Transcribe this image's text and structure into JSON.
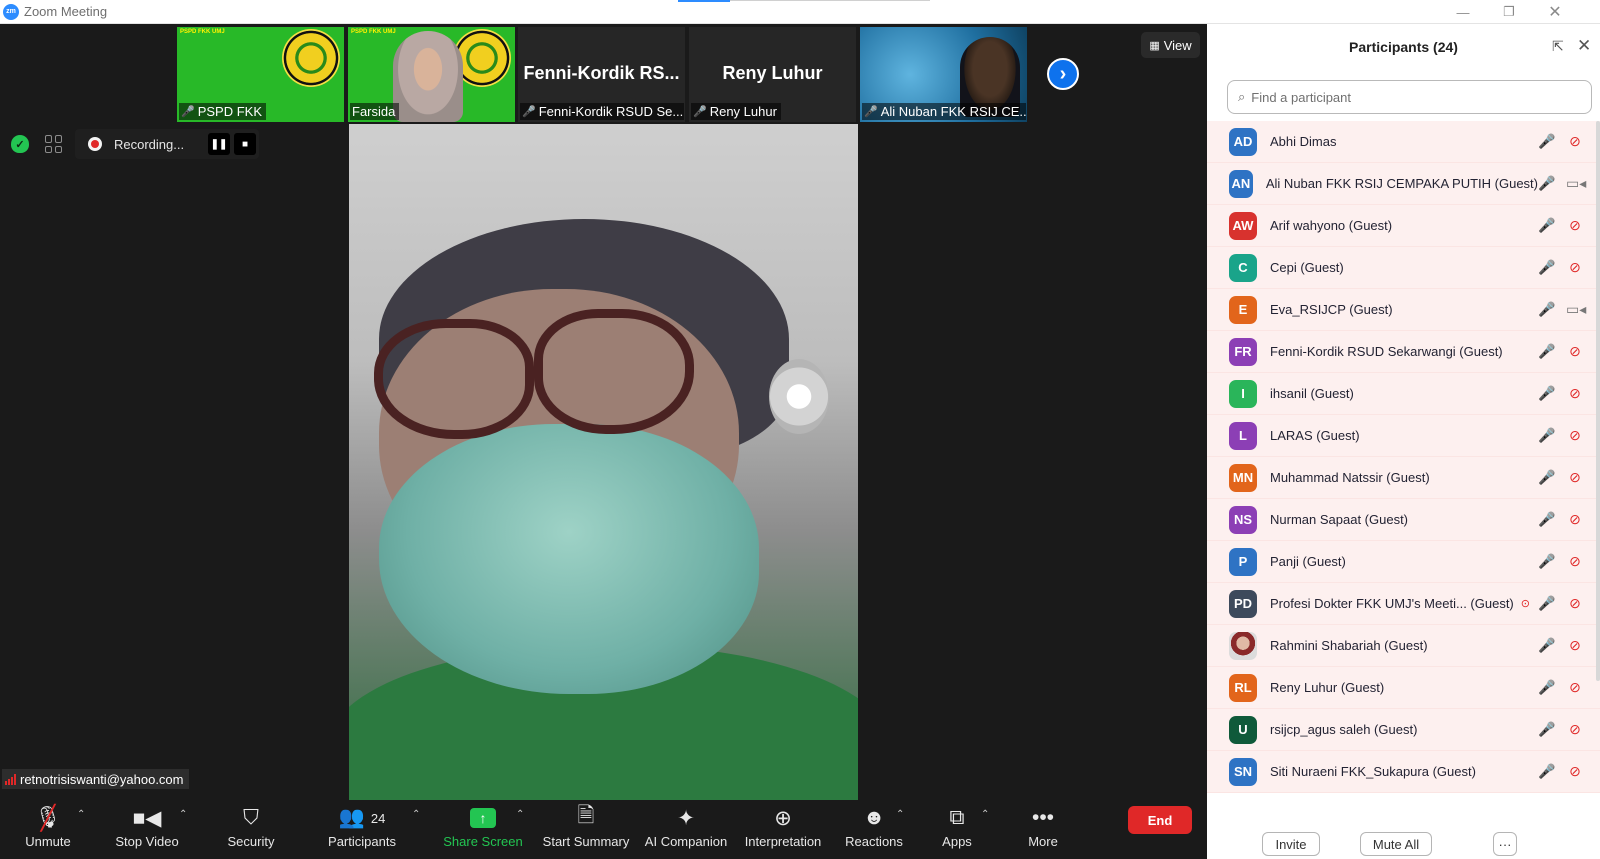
{
  "window": {
    "title": "Zoom Meeting",
    "logo": "zm"
  },
  "video_strip": {
    "tiles": [
      {
        "name": "PSPD FKK",
        "big_name": "",
        "kind": "green",
        "muted": true,
        "slide_text": "PSPD FKK UMJ"
      },
      {
        "name": "Farsida",
        "big_name": "",
        "kind": "green-face",
        "muted": false,
        "slide_text": "PSPD FKK UMJ"
      },
      {
        "name": "Fenni-Kordik RSUD Se...",
        "big_name": "Fenni-Kordik  RS...",
        "kind": "dark",
        "muted": true
      },
      {
        "name": "Reny Luhur",
        "big_name": "Reny Luhur",
        "kind": "dark",
        "muted": true
      },
      {
        "name": "Ali Nuban FKK RSIJ CE...",
        "big_name": "",
        "kind": "photo",
        "muted": true
      }
    ],
    "next_icon": "chevron-right-icon",
    "view_label": "View"
  },
  "recording": {
    "label": "Recording...",
    "pause_icon": "pause-icon",
    "stop_icon": "stop-icon"
  },
  "speaker": {
    "email_label": "retnotrisiswanti@yahoo.com"
  },
  "toolbar": {
    "unmute": "Unmute",
    "stop_video": "Stop Video",
    "security": "Security",
    "participants": "Participants",
    "participants_count": "24",
    "share_screen": "Share Screen",
    "start_summary": "Start Summary",
    "ai_companion": "AI Companion",
    "interpretation": "Interpretation",
    "reactions": "Reactions",
    "apps": "Apps",
    "more": "More",
    "end": "End"
  },
  "panel": {
    "title": "Participants (24)",
    "search_placeholder": "Find a participant",
    "participants": [
      {
        "initials": "AD",
        "name": "Abhi Dimas",
        "color": "#2e73c4",
        "camera_on": false,
        "recording": false
      },
      {
        "initials": "AN",
        "name": "Ali Nuban FKK RSIJ CEMPAKA PUTIH (Guest)",
        "color": "#2e73c4",
        "camera_on": true,
        "recording": false
      },
      {
        "initials": "AW",
        "name": "Arif wahyono (Guest)",
        "color": "#d8322e",
        "camera_on": false,
        "recording": false
      },
      {
        "initials": "C",
        "name": "Cepi (Guest)",
        "color": "#1aa48a",
        "camera_on": false,
        "recording": false
      },
      {
        "initials": "E",
        "name": "Eva_RSIJCP (Guest)",
        "color": "#e2651b",
        "camera_on": true,
        "recording": false
      },
      {
        "initials": "FR",
        "name": "Fenni-Kordik RSUD Sekarwangi (Guest)",
        "color": "#8c3fb5",
        "camera_on": false,
        "recording": false
      },
      {
        "initials": "I",
        "name": "ihsanil (Guest)",
        "color": "#2ab55a",
        "camera_on": false,
        "recording": false
      },
      {
        "initials": "L",
        "name": "LARAS (Guest)",
        "color": "#8c3fb5",
        "camera_on": false,
        "recording": false
      },
      {
        "initials": "MN",
        "name": "Muhammad Natssir (Guest)",
        "color": "#e2651b",
        "camera_on": false,
        "recording": false
      },
      {
        "initials": "NS",
        "name": "Nurman Sapaat (Guest)",
        "color": "#8c3fb5",
        "camera_on": false,
        "recording": false
      },
      {
        "initials": "P",
        "name": "Panji (Guest)",
        "color": "#2e73c4",
        "camera_on": false,
        "recording": false
      },
      {
        "initials": "PD",
        "name": "Profesi Dokter FKK UMJ's Meeti...  (Guest)",
        "color": "#3d4a5c",
        "camera_on": false,
        "recording": true
      },
      {
        "initials": "",
        "name": "Rahmini Shabariah (Guest)",
        "color": "#c9c9c9",
        "camera_on": false,
        "recording": false
      },
      {
        "initials": "RL",
        "name": "Reny Luhur (Guest)",
        "color": "#e2651b",
        "camera_on": false,
        "recording": false
      },
      {
        "initials": "U",
        "name": "rsijcp_agus saleh (Guest)",
        "color": "#0f5a3a",
        "camera_on": false,
        "recording": false
      },
      {
        "initials": "SN",
        "name": "Siti Nuraeni FKK_Sukapura (Guest)",
        "color": "#2e73c4",
        "camera_on": false,
        "recording": false
      }
    ],
    "invite_label": "Invite",
    "mute_all_label": "Mute All",
    "more_label": "···"
  }
}
